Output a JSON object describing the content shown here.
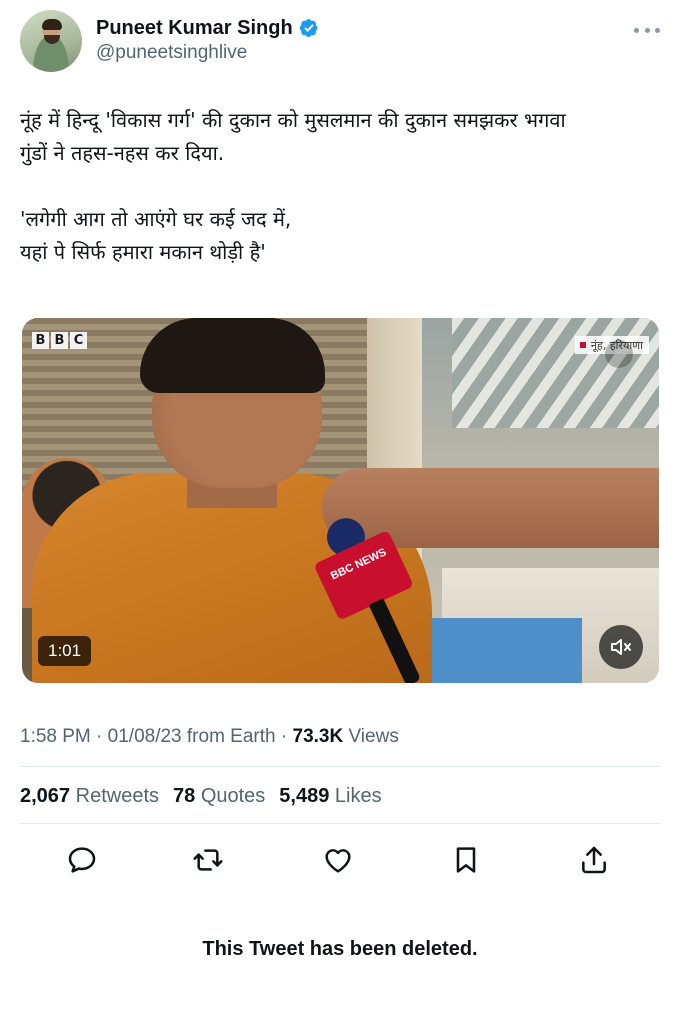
{
  "author": {
    "display_name": "Puneet Kumar Singh",
    "handle": "@puneetsinghlive",
    "verified": true,
    "avatar_icon": "profile-photo"
  },
  "tweet": {
    "line1": "नूंह में हिन्दू 'विकास गर्ग' की दुकान को मुसलमान की दुकान समझकर भगवा",
    "line2": "गुंडों ने तहस-नहस कर दिया.",
    "line3": "'लगेगी आग तो आएंगे घर कई जद में,",
    "line4": "यहां पे सिर्फ हमारा मकान थोड़ी है'"
  },
  "media": {
    "logo_b1": "B",
    "logo_b2": "B",
    "logo_c": "C",
    "location": "नूंह, हरियाणा",
    "mic_flag": "BBC NEWS",
    "duration": "1:01",
    "mute_icon": "speaker-muted-icon"
  },
  "meta": {
    "time": "1:58 PM",
    "sep1": " · ",
    "date": "01/08/23",
    "source": " from Earth",
    "sep2": " · ",
    "views_count": "73.3K",
    "views_label": " Views"
  },
  "stats": {
    "retweets_count": "2,067",
    "retweets_label": "Retweets",
    "quotes_count": "78",
    "quotes_label": "Quotes",
    "likes_count": "5,489",
    "likes_label": "Likes"
  },
  "actions": [
    "reply-icon",
    "retweet-icon",
    "like-icon",
    "bookmark-icon",
    "share-icon"
  ],
  "footer": {
    "deleted_notice": "This Tweet has been deleted."
  },
  "colors": {
    "verified": "#1d9bf0",
    "secondary_text": "#536471",
    "primary_text": "#0f1419"
  }
}
